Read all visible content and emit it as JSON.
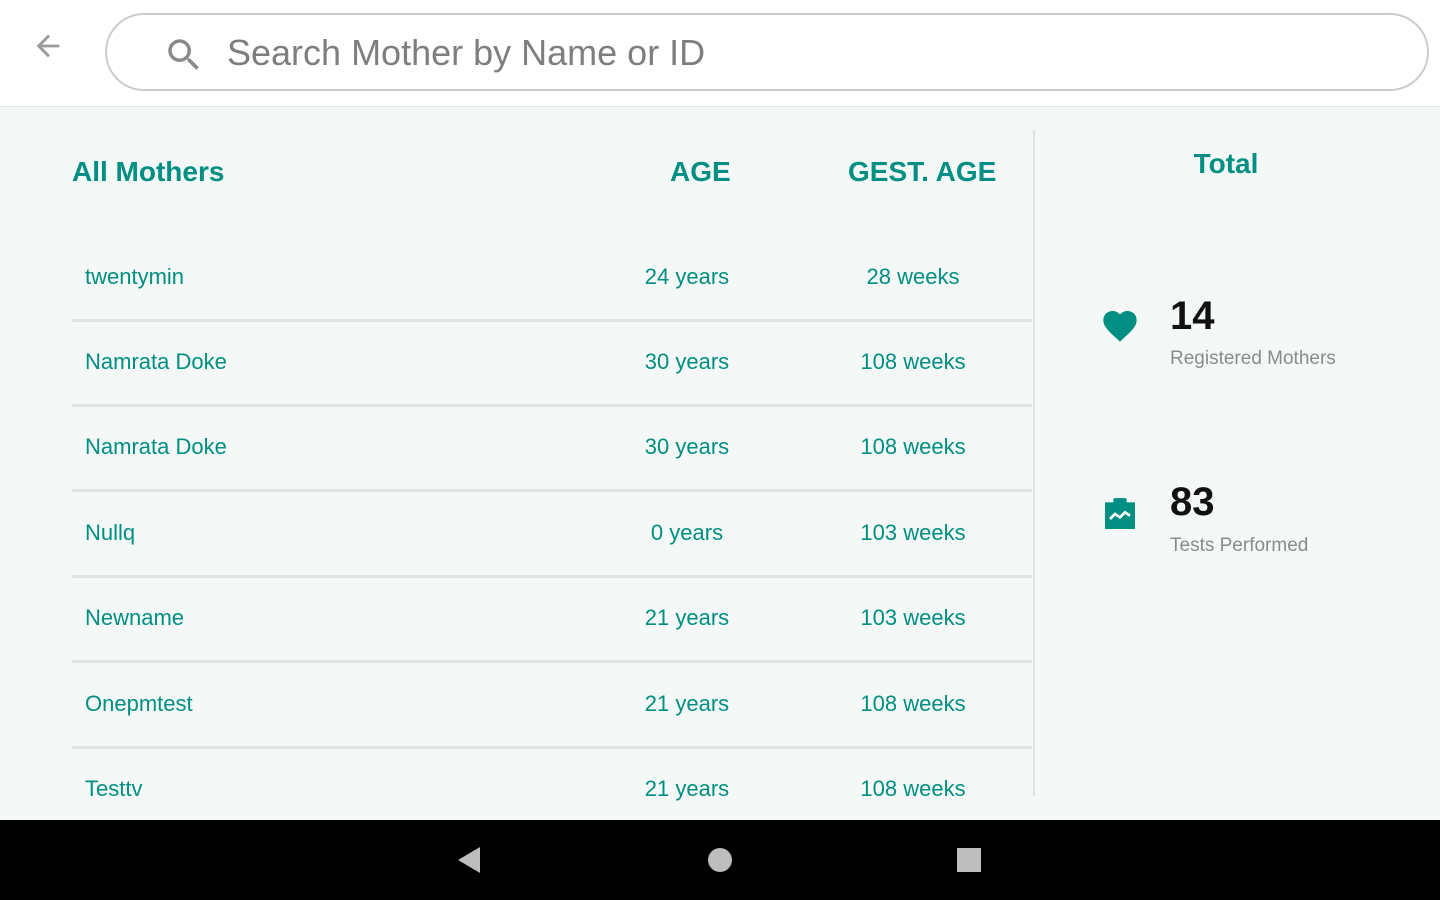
{
  "search": {
    "placeholder": "Search Mother by Name or ID"
  },
  "table": {
    "headers": {
      "name": "All Mothers",
      "age": "AGE",
      "gest_age": "GEST. AGE"
    },
    "rows": [
      {
        "name": "twentymin",
        "age": "24 years",
        "gest_age": "28 weeks"
      },
      {
        "name": "Namrata Doke",
        "age": "30 years",
        "gest_age": "108 weeks"
      },
      {
        "name": "Namrata Doke",
        "age": "30 years",
        "gest_age": "108 weeks"
      },
      {
        "name": "Nullq",
        "age": "0 years",
        "gest_age": "103 weeks"
      },
      {
        "name": "Newname",
        "age": "21 years",
        "gest_age": "103 weeks"
      },
      {
        "name": "Onepmtest",
        "age": "21 years",
        "gest_age": "108 weeks"
      },
      {
        "name": "Testtv",
        "age": "21 years",
        "gest_age": "108 weeks"
      }
    ]
  },
  "stats": {
    "title": "Total",
    "registered": {
      "count": "14",
      "label": "Registered Mothers",
      "icon": "heart-icon"
    },
    "tests": {
      "count": "83",
      "label": "Tests Performed",
      "icon": "chart-clipboard-icon"
    }
  },
  "colors": {
    "accent": "#008f82",
    "background": "#f4f8f6",
    "navbar": "#000000"
  }
}
